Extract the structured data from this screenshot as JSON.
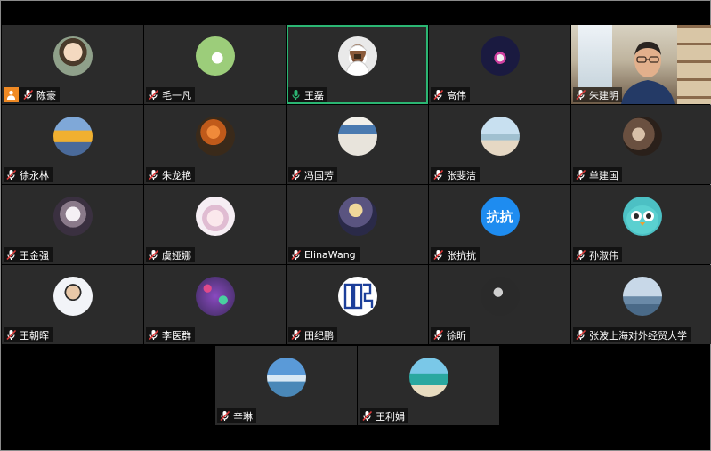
{
  "participants": [
    {
      "name": "陈豪",
      "avatar": "child-photo",
      "bg": "#6b7f6a",
      "host": true,
      "mic": "muted"
    },
    {
      "name": "毛一凡",
      "avatar": "cartoon-green",
      "bg": "#8bbf6a",
      "mic": "muted"
    },
    {
      "name": "王磊",
      "avatar": "cartoon-man",
      "bg": "#f2f2f2",
      "mic": "active",
      "active": true
    },
    {
      "name": "高伟",
      "avatar": "night-photo",
      "bg": "#3a3a6a",
      "mic": "muted"
    },
    {
      "name": "朱建明",
      "avatar": "video",
      "bg": "#c9bfa8",
      "mic": "muted",
      "video": true
    },
    {
      "name": "徐永林",
      "avatar": "lake-photo",
      "bg": "#d9a23a",
      "mic": "muted"
    },
    {
      "name": "朱龙艳",
      "avatar": "flower-photo",
      "bg": "#b4531e",
      "mic": "muted"
    },
    {
      "name": "冯国芳",
      "avatar": "bookshelf-photo",
      "bg": "#d8d4cc",
      "mic": "muted"
    },
    {
      "name": "张斐洁",
      "avatar": "beach-photo",
      "bg": "#b9d6e6",
      "mic": "muted"
    },
    {
      "name": "单建国",
      "avatar": "abstract-photo",
      "bg": "#5a4a40",
      "mic": "muted"
    },
    {
      "name": "王金强",
      "avatar": "blossom-photo",
      "bg": "#9aa4b4",
      "mic": "muted"
    },
    {
      "name": "虞娅娜",
      "avatar": "anime-girl",
      "bg": "#e9d9e4",
      "mic": "muted"
    },
    {
      "name": "ElinaWang",
      "avatar": "moon-photo",
      "bg": "#4a4668",
      "mic": "muted"
    },
    {
      "name": "张抗抗",
      "avatar": "text",
      "avatarText": "抗抗",
      "bg": "#1e8cf0",
      "mic": "muted"
    },
    {
      "name": "孙淑伟",
      "avatar": "owl",
      "bg": "#4cc0c4",
      "mic": "muted"
    },
    {
      "name": "王朝晖",
      "avatar": "man-photo",
      "bg": "#eef0f4",
      "mic": "muted"
    },
    {
      "name": "李医群",
      "avatar": "confetti-photo",
      "bg": "#6a4a8a",
      "mic": "muted"
    },
    {
      "name": "田纪鹏",
      "avatar": "seal",
      "bg": "#ffffff",
      "mic": "muted"
    },
    {
      "name": "徐昕",
      "avatar": "bw-photo",
      "bg": "#1a1a1a",
      "mic": "muted"
    },
    {
      "name": "张波上海对外经贸大学",
      "avatar": "sea-photo",
      "bg": "#8aa4bc",
      "mic": "muted"
    }
  ],
  "last_row": [
    {
      "name": "辛琳",
      "avatar": "bird-sky",
      "bg": "#6aa6d8",
      "mic": "muted"
    },
    {
      "name": "王利娟",
      "avatar": "tropical-photo",
      "bg": "#3aa0b0",
      "mic": "muted"
    }
  ],
  "colors": {
    "tile_bg": "#2b2b2b",
    "active_border": "#2bb673",
    "muted_icon": "#e03b3b",
    "host_badge": "#f08a24"
  }
}
